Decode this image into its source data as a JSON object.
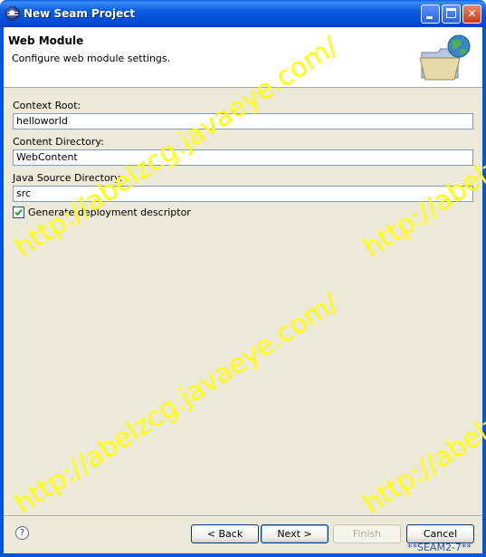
{
  "window": {
    "title": "New Seam Project"
  },
  "banner": {
    "title": "Web Module",
    "description": "Configure web module settings."
  },
  "form": {
    "context_root_label": "Context Root:",
    "context_root_value": "helloworld",
    "content_dir_label": "Content Directory:",
    "content_dir_value": "WebContent",
    "java_src_label": "Java Source Directory:",
    "java_src_value": "src",
    "descriptor_label": "Generate deployment descriptor",
    "descriptor_checked": true
  },
  "buttons": {
    "back": "< Back",
    "next": "Next >",
    "finish": "Finish",
    "cancel": "Cancel",
    "help": "?"
  },
  "watermark": {
    "text": "http://abelzcg.javaeye.com/"
  },
  "caption": "**SEAM2-7**",
  "colors": {
    "titlebar": "#0054e3",
    "dialog_bg": "#ece9d8",
    "watermark": "#ffff00",
    "caption": "#3050c8"
  }
}
